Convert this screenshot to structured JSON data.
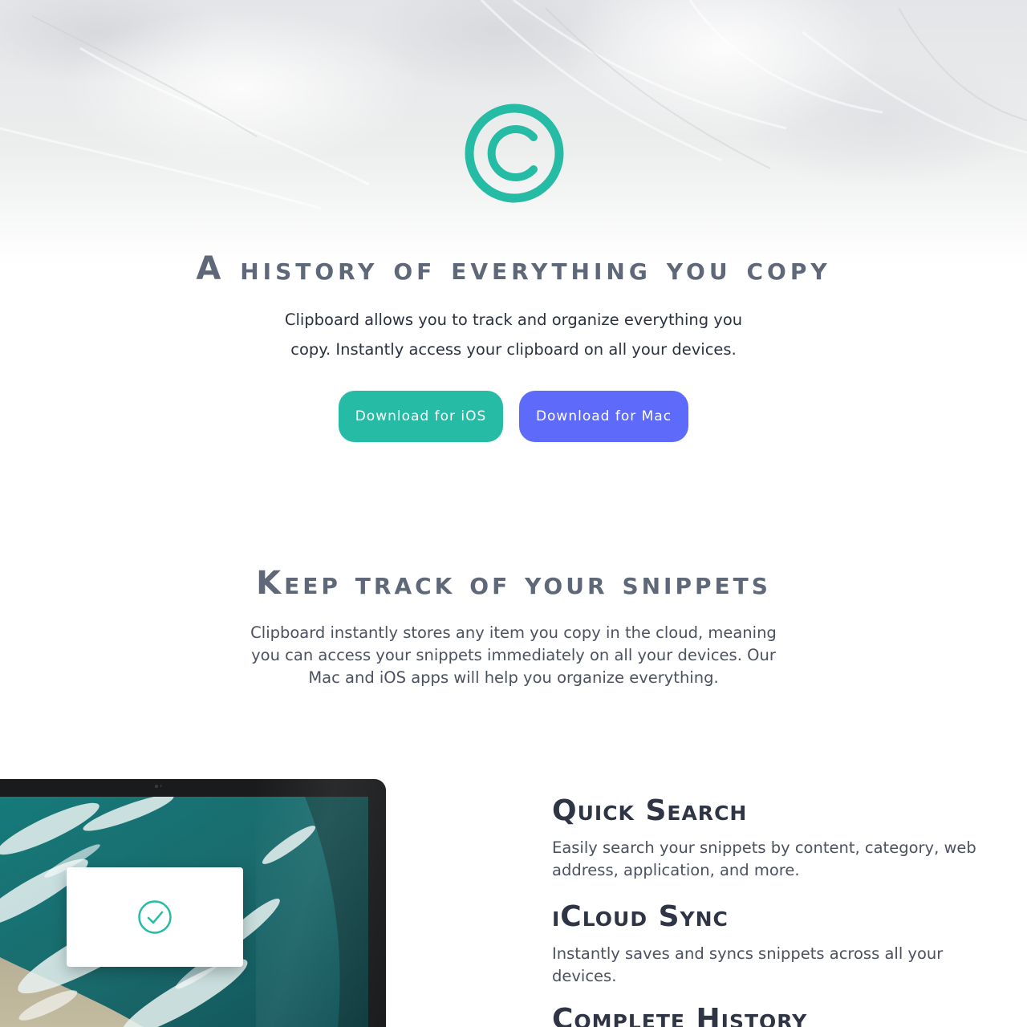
{
  "colors": {
    "accent_teal": "#26bba4",
    "accent_indigo": "#5d6afa",
    "heading": "#5f6878",
    "feature_heading": "#2f3544"
  },
  "hero": {
    "logo_icon": "copyright-c-icon",
    "title": "A history of everything you copy",
    "description": "Clipboard allows you to track and organize everything you copy. Instantly access your clipboard on all your devices.",
    "buttons": {
      "ios_label": "Download for iOS",
      "mac_label": "Download for Mac"
    }
  },
  "snippets": {
    "title": "Keep track of your snippets",
    "description": "Clipboard instantly stores any item you copy in the cloud, meaning you can access your snippets immediately on all your devices. Our Mac and iOS apps will help you organize everything."
  },
  "features": [
    {
      "title": "Quick Search",
      "description": "Easily search your snippets by content, category, web address, application, and more."
    },
    {
      "title": "iCloud Sync",
      "description": "Instantly saves and syncs snippets across all your devices."
    },
    {
      "title": "Complete History",
      "description": ""
    }
  ],
  "laptop": {
    "toast_icon": "check-circle-icon"
  }
}
